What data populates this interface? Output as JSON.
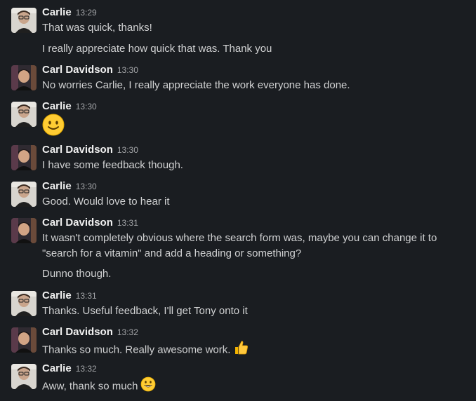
{
  "messages": [
    {
      "author": "Carlie",
      "time": "13:29",
      "lines": [
        "That was quick, thanks!",
        "I really appreciate how quick that was. Thank you"
      ]
    },
    {
      "author": "Carl Davidson",
      "time": "13:30",
      "lines": [
        "No worries Carlie, I really appreciate the work everyone has done."
      ]
    },
    {
      "author": "Carlie",
      "time": "13:30",
      "emoji": "slightly-smiling-face-icon"
    },
    {
      "author": "Carl Davidson",
      "time": "13:30",
      "lines": [
        "I have some feedback though."
      ]
    },
    {
      "author": "Carlie",
      "time": "13:30",
      "lines": [
        "Good. Would love to hear it"
      ]
    },
    {
      "author": "Carl Davidson",
      "time": "13:31",
      "lines": [
        "It wasn't completely obvious where the search form was, maybe you can change it to \"search for a vitamin\" and add a heading or something?",
        "Dunno though."
      ]
    },
    {
      "author": "Carlie",
      "time": "13:31",
      "lines": [
        "Thanks. Useful feedback, I'll get Tony onto it"
      ]
    },
    {
      "author": "Carl Davidson",
      "time": "13:32",
      "lines": [
        "Thanks so much. Really awesome work."
      ],
      "emoji": "thumbs-up-icon"
    },
    {
      "author": "Carlie",
      "time": "13:32",
      "lines": [
        "Aww, thank so much"
      ],
      "emoji": "grinning-face-icon"
    }
  ],
  "colors": {
    "background": "#1a1d21",
    "text": "#d1d2d3",
    "author": "#f0f0f0",
    "timestamp": "#a3a5a8"
  }
}
